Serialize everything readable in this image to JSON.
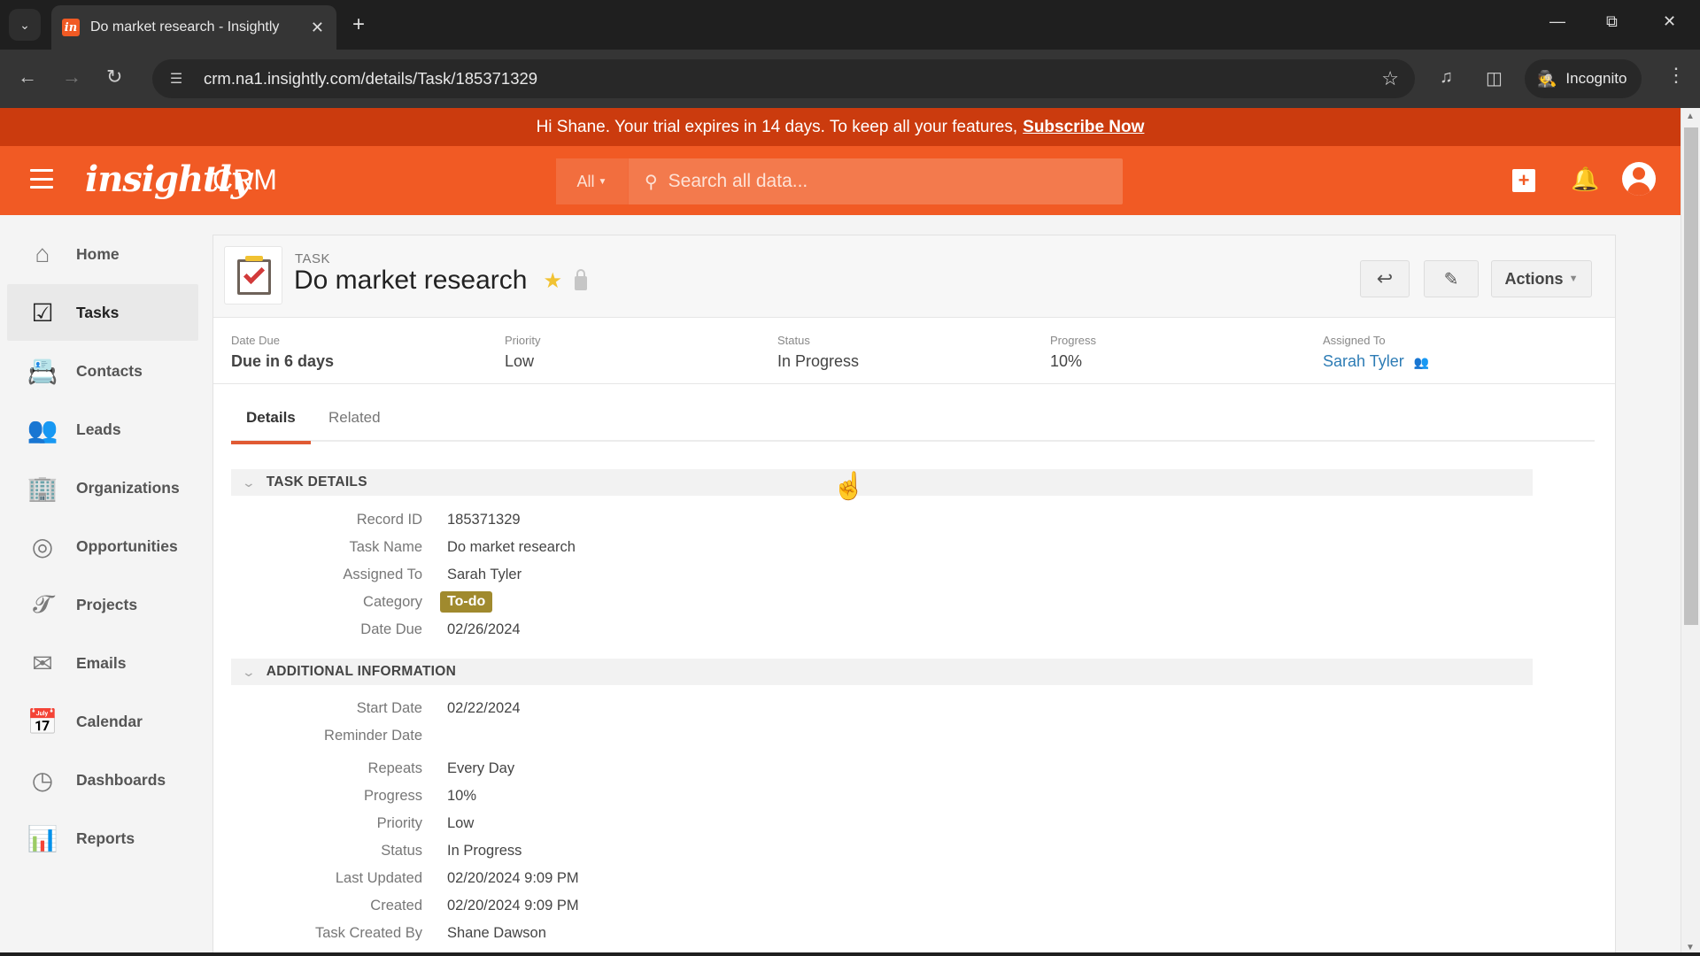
{
  "browser": {
    "tab_title": "Do market research - Insightly",
    "url": "crm.na1.insightly.com/details/Task/185371329",
    "incognito_label": "Incognito"
  },
  "banner": {
    "text": "Hi Shane. Your trial expires in 14 days. To keep all your features,",
    "link": "Subscribe Now"
  },
  "header": {
    "logo": "insightly",
    "product": "CRM",
    "search_scope": "All",
    "search_placeholder": "Search all data..."
  },
  "sidebar": {
    "items": [
      {
        "label": "Home",
        "icon": "home-icon"
      },
      {
        "label": "Tasks",
        "icon": "tasks-icon",
        "active": true
      },
      {
        "label": "Contacts",
        "icon": "contacts-icon"
      },
      {
        "label": "Leads",
        "icon": "leads-icon"
      },
      {
        "label": "Organizations",
        "icon": "organizations-icon"
      },
      {
        "label": "Opportunities",
        "icon": "opportunities-icon"
      },
      {
        "label": "Projects",
        "icon": "projects-icon"
      },
      {
        "label": "Emails",
        "icon": "emails-icon"
      },
      {
        "label": "Calendar",
        "icon": "calendar-icon"
      },
      {
        "label": "Dashboards",
        "icon": "dashboards-icon"
      },
      {
        "label": "Reports",
        "icon": "reports-icon"
      }
    ]
  },
  "record": {
    "type": "TASK",
    "title": "Do market research",
    "actions_label": "Actions"
  },
  "summary": {
    "date_due_label": "Date Due",
    "date_due": "Due in 6 days",
    "priority_label": "Priority",
    "priority": "Low",
    "status_label": "Status",
    "status": "In Progress",
    "progress_label": "Progress",
    "progress": "10%",
    "assigned_label": "Assigned To",
    "assigned": "Sarah Tyler"
  },
  "tabs": [
    "Details",
    "Related"
  ],
  "task_details": {
    "title": "TASK DETAILS",
    "fields": [
      {
        "label": "Record ID",
        "value": "185371329"
      },
      {
        "label": "Task Name",
        "value": "Do market research"
      },
      {
        "label": "Assigned To",
        "value": "Sarah Tyler"
      },
      {
        "label": "Category",
        "value": "To-do"
      },
      {
        "label": "Date Due",
        "value": "02/26/2024"
      }
    ]
  },
  "additional_info": {
    "title": "ADDITIONAL INFORMATION",
    "fields": [
      {
        "label": "Start Date",
        "value": "02/22/2024"
      },
      {
        "label": "Reminder Date",
        "value": ""
      },
      {
        "label": "Repeats",
        "value": "Every Day"
      },
      {
        "label": "Progress",
        "value": "10%"
      },
      {
        "label": "Priority",
        "value": "Low"
      },
      {
        "label": "Status",
        "value": "In Progress"
      },
      {
        "label": "Last Updated",
        "value": "02/20/2024 9:09 PM"
      },
      {
        "label": "Created",
        "value": "02/20/2024 9:09 PM"
      },
      {
        "label": "Task Created By",
        "value": "Shane Dawson"
      }
    ]
  },
  "colors": {
    "brand": "#f15a24",
    "banner": "#cb3b0e",
    "link": "#2d7cb5",
    "category_chip": "#a08a2e"
  }
}
